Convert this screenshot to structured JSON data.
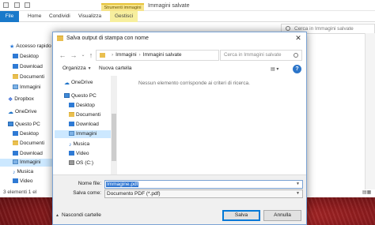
{
  "explorer": {
    "title": "Immagini salvate",
    "context_tab": "Strumenti immagini",
    "tabs": [
      "File",
      "Home",
      "Condividi",
      "Visualizza",
      "Gestisci"
    ],
    "search_placeholder": "Cerca in Immagini salvate",
    "nav": {
      "quick_access": "Accesso rapido",
      "desktop": "Desktop",
      "download": "Download",
      "documenti": "Documenti",
      "immagini": "Immagini",
      "dropbox": "Dropbox",
      "onedrive": "OneDrive",
      "questo_pc": "Questo PC",
      "desktop2": "Desktop",
      "documenti2": "Documenti",
      "download2": "Download",
      "immagini2": "Immagini",
      "musica": "Musica",
      "video": "Video"
    },
    "status": "3 elementi  1 el"
  },
  "dialog": {
    "title": "Salva output di stampa con nome",
    "path": [
      "Immagini",
      "Immagini salvate"
    ],
    "search_placeholder": "Cerca in Immagini salvate",
    "toolbar": {
      "organize": "Organizza",
      "new_folder": "Nuova cartella"
    },
    "tree": {
      "onedrive": "OneDrive",
      "questo_pc": "Questo PC",
      "desktop": "Desktop",
      "documenti": "Documenti",
      "download": "Download",
      "immagini": "Immagini",
      "musica": "Musica",
      "video": "Video",
      "os_c": "OS (C:)"
    },
    "empty_message": "Nessun elemento corrisponde ai criteri di ricerca.",
    "file_name_label": "Nome file:",
    "file_name_value": "Immagine.pdf",
    "save_as_label": "Salva come:",
    "save_as_value": "Documento PDF (*.pdf)",
    "hide_folders": "Nascondi cartelle",
    "save_button": "Salva",
    "cancel_button": "Annulla"
  },
  "colors": {
    "accent": "#1979ca",
    "context_tab": "#f6e48a",
    "selection": "#3077d3"
  }
}
